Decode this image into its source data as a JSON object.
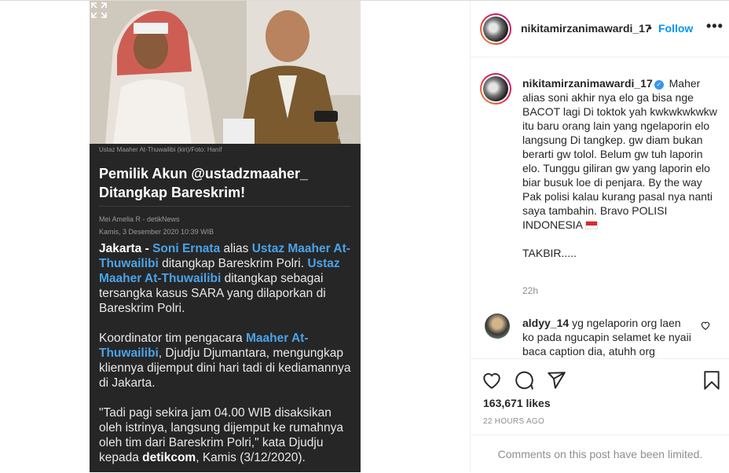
{
  "post": {
    "photo_caption": "Ustaz Maaher At-Thuwailibi (kiri)/Foto: Hanif",
    "watermark": "detik",
    "headline_line1": "Pemilik Akun @ustadzmaaher_",
    "headline_line2": "Ditangkap Bareskrim!",
    "byline_author": "Mei Amelia R - detikNews",
    "byline_date": "Kamis, 3 Desember 2020 10:39 WIB",
    "p1": {
      "city": "Jakarta - ",
      "name1": "Soni Ernata",
      "t1": " alias ",
      "name2": "Ustaz Maaher At-Thuwailibi",
      "t2": " ditangkap Bareskrim Polri. ",
      "name3": "Ustaz Maaher At-Thuwailibi",
      "t3": " ditangkap sebagai tersangka kasus SARA yang dilaporkan di Bareskrim Polri."
    },
    "p2": {
      "t1": "Koordinator tim pengacara ",
      "name1": "Maaher At-Thuwailibi",
      "t2": ", Djudju Djumantara, mengungkap kliennya dijemput dini hari tadi di kediamannya di Jakarta."
    },
    "p3": {
      "t1": "\"Tadi pagi sekira jam 04.00 WIB disaksikan oleh istrinya, langsung dijemput ke rumahnya oleh tim dari Bareskrim Polri,\" kata Djudju kepada ",
      "brand": "detikcom",
      "t2": ", Kamis (3/12/2020)."
    }
  },
  "header": {
    "username": "nikitamirzanimawardi_17",
    "dot": "•",
    "follow_label": "Follow",
    "more_label": "•••"
  },
  "caption": {
    "username": "nikitamirzanimawardi_17",
    "verified": "✓",
    "text": "Maher alias soni akhir nya elo ga bisa nge BACOT lagi Di toktok yah kwkwkwkwkw itu baru orang lain yang ngelaporin elo langsung Di tangkep. gw diam bukan berarti gw tolol. Belum gw tuh laporin elo. Tunggu giliran gw yang laporin elo biar busuk loe di penjara. By the way Pak polisi kalau kurang pasal nya nanti saya tambahin. Bravo POLISI INDONESIA ",
    "text2": "TAKBIR.....",
    "time": "22h"
  },
  "comment": {
    "username": "aldyy_14",
    "text": "yg ngelaporin org laen ko pada ngucapin selamet ke nyaii baca caption dia, atuhh org"
  },
  "stats": {
    "likes": "163,671 likes",
    "time_ago": "22 HOURS AGO"
  },
  "footer": {
    "limited": "Comments on this post have been limited."
  },
  "icons": [
    "expand-icon",
    "heart-icon",
    "comment-icon",
    "share-icon",
    "bookmark-icon",
    "verified-icon",
    "flag-indonesia-icon"
  ],
  "colors": {
    "link": "#0095f6",
    "article_link": "#4aa3e8",
    "verified": "#3897f0"
  }
}
